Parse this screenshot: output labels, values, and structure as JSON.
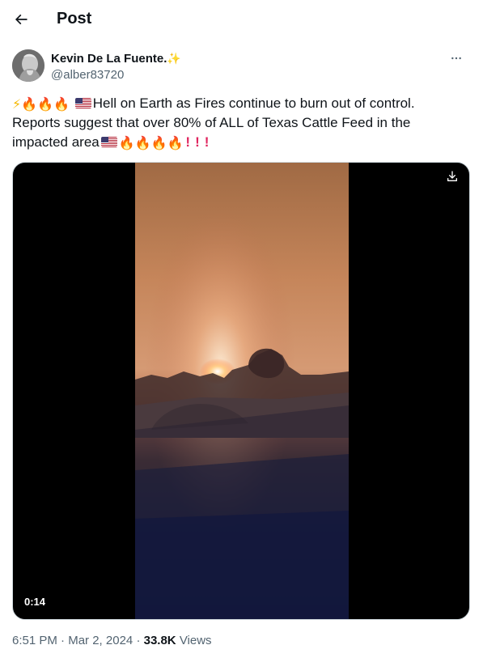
{
  "header": {
    "title": "Post"
  },
  "author": {
    "display_name": "Kevin De La Fuente.",
    "verified_emoji": "✨",
    "handle": "@alber83720"
  },
  "tweet": {
    "prefix_emojis": [
      "⚡",
      "🔥",
      "🔥",
      "🔥"
    ],
    "line1": "Hell on Earth as Fires continue to burn out of control.",
    "line2": "Reports suggest that over 80% of ALL of Texas Cattle Feed in the",
    "line3": "impacted area",
    "suffix_emojis": [
      "🔥",
      "🔥",
      "🔥",
      "🔥"
    ],
    "bangs": [
      "!",
      "!",
      "!"
    ]
  },
  "media": {
    "duration": "0:14"
  },
  "meta": {
    "time": "6:51 PM",
    "separator": "·",
    "date": "Mar 2, 2024",
    "views_count": "33.8K",
    "views_label": "Views"
  },
  "colors": {
    "text": "#0f1419",
    "secondary": "#536471",
    "fire": "#f36b1c",
    "bang": "#e0245e"
  }
}
